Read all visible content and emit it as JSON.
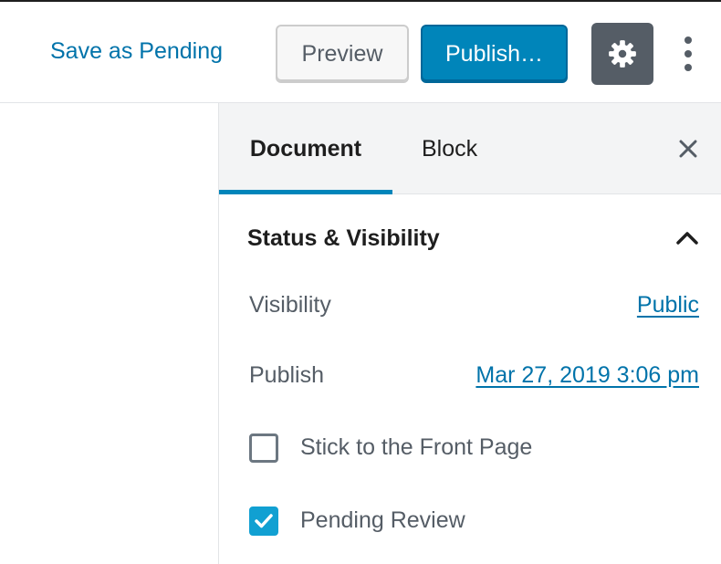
{
  "header": {
    "save_as_pending_label": "Save as Pending",
    "preview_label": "Preview",
    "publish_label": "Publish…",
    "settings_icon": "gear-icon",
    "more_icon": "more-vertical-icon"
  },
  "sidebar": {
    "tabs": [
      {
        "label": "Document",
        "active": true
      },
      {
        "label": "Block",
        "active": false
      }
    ],
    "close_icon": "close-icon",
    "panel": {
      "title": "Status & Visibility",
      "expanded": true,
      "visibility_label": "Visibility",
      "visibility_value": "Public",
      "publish_label": "Publish",
      "publish_value": "Mar 27, 2019 3:06 pm",
      "checkboxes": [
        {
          "label": "Stick to the Front Page",
          "checked": false
        },
        {
          "label": "Pending Review",
          "checked": true
        }
      ]
    }
  },
  "colors": {
    "primary": "#0085ba",
    "link": "#0073aa",
    "settings_button_bg": "#555d66",
    "checkbox_checked": "#11a0d2",
    "text_muted": "#555d66"
  }
}
